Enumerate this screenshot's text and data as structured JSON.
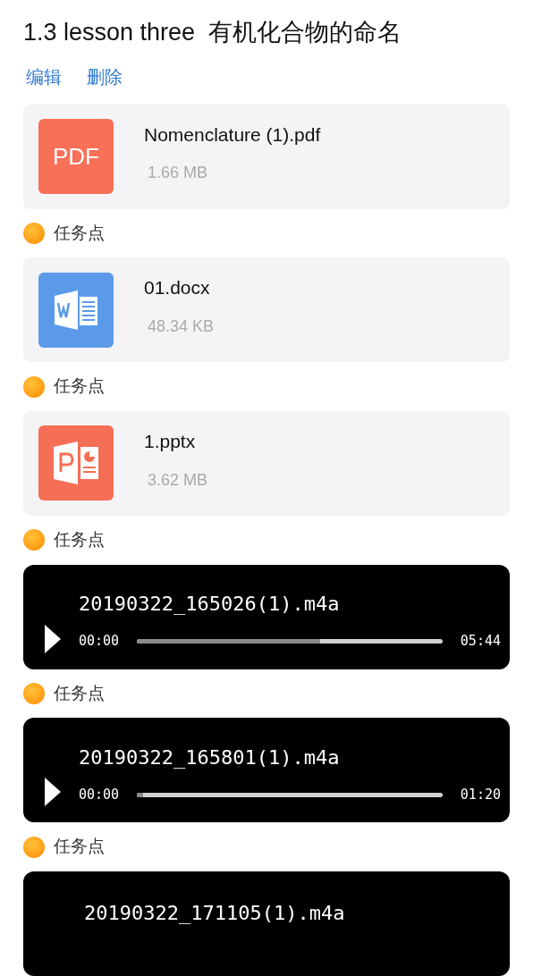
{
  "title": "1.3 lesson three  有机化合物的命名",
  "actions": [
    {
      "label": "编辑"
    },
    {
      "label": "删除"
    }
  ],
  "items": [
    {
      "kind": "pdf",
      "name": "Nomenclature (1).pdf",
      "size": "1.66 MB",
      "icon_text": "PDF",
      "task_point": "任务点"
    },
    {
      "kind": "docx",
      "name": "01.docx",
      "size": "48.34 KB",
      "task_point": "任务点"
    },
    {
      "kind": "pptx",
      "name": "1.pptx",
      "size": "3.62 MB",
      "task_point": "任务点"
    },
    {
      "kind": "audio",
      "name": "20190322_165026(1).m4a",
      "current": "00:00",
      "duration": "05:44",
      "level": 0.6,
      "task_point": "任务点"
    },
    {
      "kind": "audio",
      "name": "20190322_165801(1).m4a",
      "current": "00:00",
      "duration": "01:20",
      "level": 0.02,
      "task_point": "任务点"
    },
    {
      "kind": "audio",
      "name": "20190322_171105(1).m4a"
    }
  ]
}
